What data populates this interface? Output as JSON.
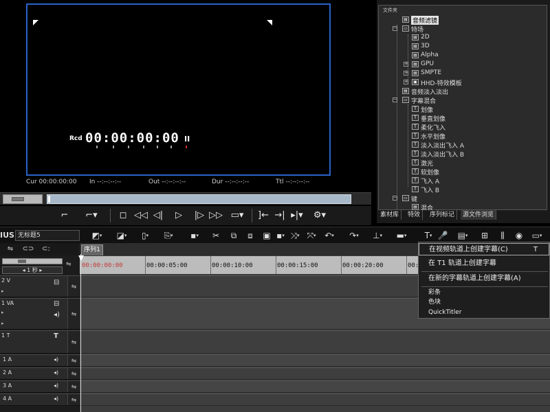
{
  "player": {
    "rcd_label": "Rcd",
    "rcd_timecode": "00:00:00:00",
    "pause_symbol": "II",
    "cur": "Cur 00:00:00:00",
    "in": "In --:--:--:--",
    "out": "Out --:--:--:--",
    "dur": "Dur --:--:--:--",
    "ttl": "Ttl --:--:--:--",
    "frame_border_color": "#2a63c9"
  },
  "library": {
    "header": "文件夹",
    "tree": [
      {
        "label": "音频滤镜",
        "selected": true
      },
      {
        "label": "特场"
      },
      {
        "label": "2D"
      },
      {
        "label": "3D"
      },
      {
        "label": "Alpha"
      },
      {
        "label": "GPU"
      },
      {
        "label": "SMPTE"
      },
      {
        "label": "HHD-特效模板"
      },
      {
        "label": "音频淡入淡出"
      },
      {
        "label": "字幕混合"
      },
      {
        "label": "划像"
      },
      {
        "label": "垂直划像"
      },
      {
        "label": "柔化飞入"
      },
      {
        "label": "水平划像"
      },
      {
        "label": "淡入淡出飞入 A"
      },
      {
        "label": "淡入淡出飞入 B"
      },
      {
        "label": "激光"
      },
      {
        "label": "软划像"
      },
      {
        "label": "飞入 A"
      },
      {
        "label": "飞入 B"
      },
      {
        "label": "键"
      },
      {
        "label": "混合"
      }
    ],
    "tabs": [
      "素材库",
      "特效",
      "序列标记",
      "源文件浏览"
    ],
    "active_tab": "源文件浏览"
  },
  "toolbar": {
    "brand": "IUS",
    "project_name": "无标题5",
    "icons": [
      "video-clip-icon",
      "audio-clip-icon",
      "new-icon",
      "import-icon",
      "save-icon",
      "cut-icon",
      "copy-icon",
      "paste-icon",
      "delete-icon",
      "ripple-delete-icon",
      "link-icon",
      "undo-icon",
      "redo-icon",
      "split-icon",
      "insert-icon",
      "title-icon",
      "mic-icon",
      "render-icon",
      "multicam-icon",
      "mixer-icon",
      "color-icon",
      "output-icon"
    ]
  },
  "timeline": {
    "sequence_tab": "序列1",
    "scale": "1 秒",
    "ruler_labels": [
      "00:00:00:00",
      "00:00:05:00",
      "00:00:10:00",
      "00:00:15:00",
      "00:00:20:00",
      "00:00:25:00"
    ],
    "tracks": [
      {
        "name": "2 V",
        "type": "video"
      },
      {
        "name": "1 VA",
        "type": "videoaudio"
      },
      {
        "name": "1 T",
        "type": "title"
      },
      {
        "name": "1 A",
        "type": "audio"
      },
      {
        "name": "2 A",
        "type": "audio"
      },
      {
        "name": "3 A",
        "type": "audio"
      },
      {
        "name": "4 A",
        "type": "audio"
      }
    ]
  },
  "context_menu": {
    "items": [
      {
        "label": "在视频轨道上创建字幕(C)",
        "shortcut": "T"
      },
      {
        "label": "在 T1 轨道上创建字幕",
        "shortcut": ""
      },
      {
        "label": "在新的字幕轨道上创建字幕(A)",
        "shortcut": ""
      },
      {
        "label": "彩条",
        "shortcut": ""
      },
      {
        "label": "色块",
        "shortcut": ""
      },
      {
        "label": "QuickTitler",
        "shortcut": ""
      }
    ]
  }
}
